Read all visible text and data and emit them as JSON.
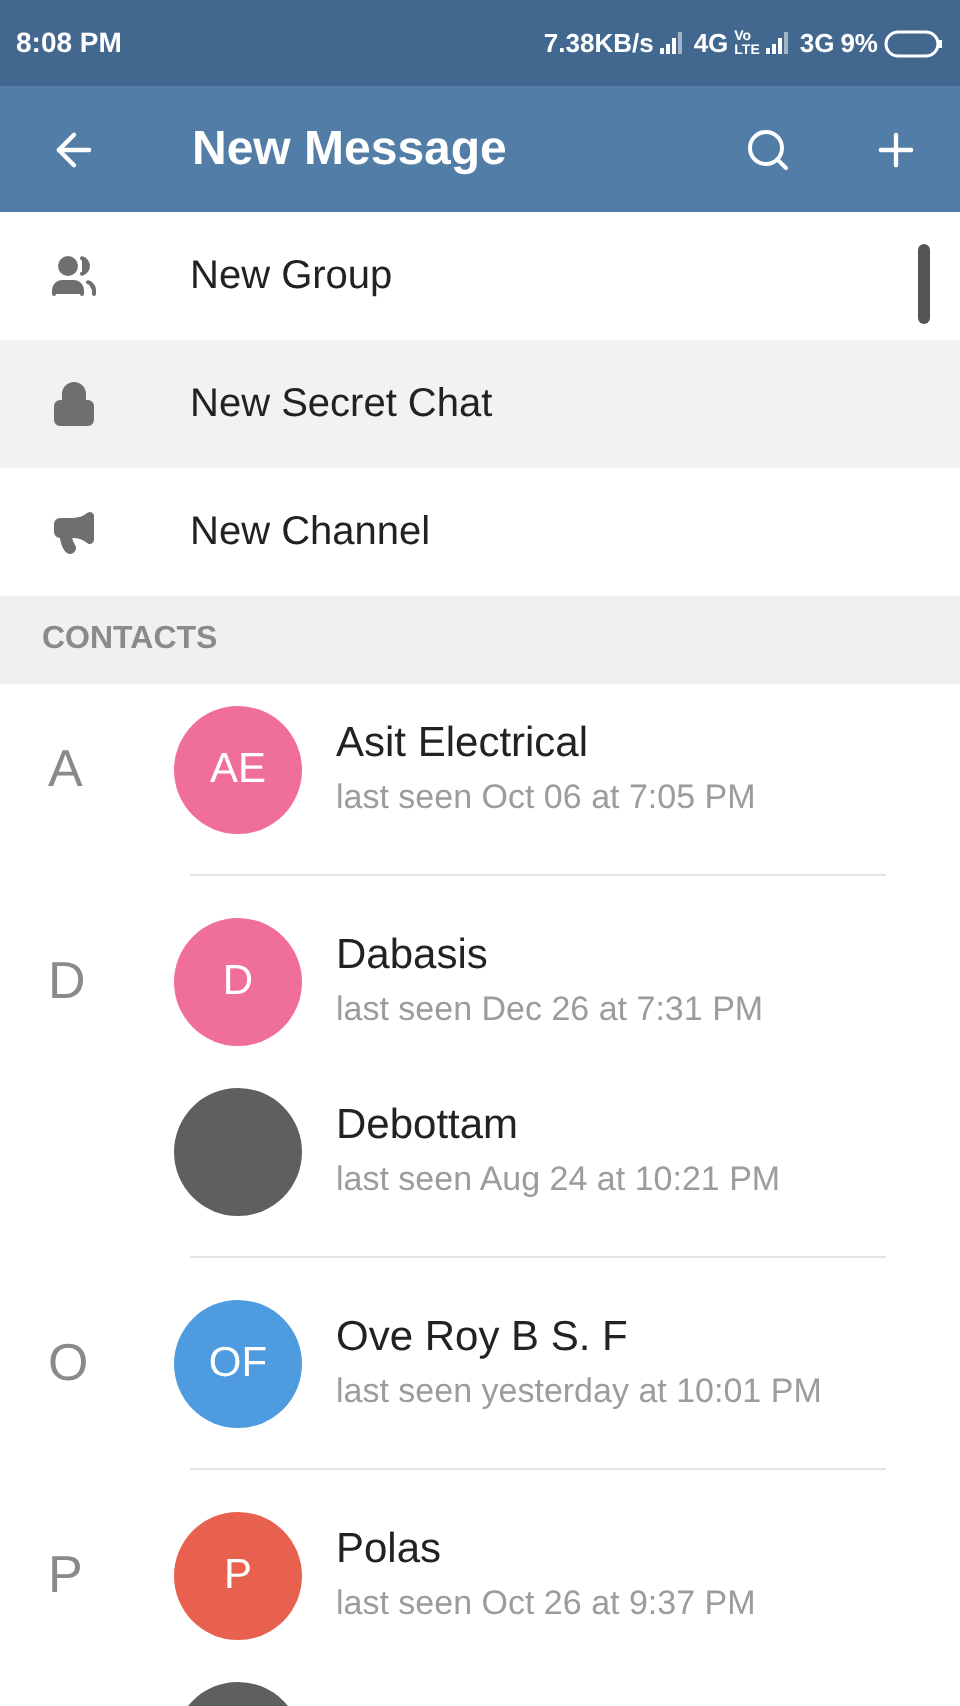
{
  "status_bar": {
    "time": "8:08 PM",
    "speed": "7.38KB/s",
    "network_1": "4G",
    "volte": [
      "Vo",
      "LTE"
    ],
    "network_2": "3G",
    "battery": "9%"
  },
  "header": {
    "title": "New Message"
  },
  "actions": [
    {
      "kind": "group",
      "label": "New Group",
      "highlighted": false
    },
    {
      "kind": "secret",
      "label": "New Secret Chat",
      "highlighted": true
    },
    {
      "kind": "channel",
      "label": "New Channel",
      "highlighted": false
    }
  ],
  "contacts_header": "CONTACTS",
  "sections": [
    {
      "letter": "A",
      "contacts": [
        {
          "kind": "initials",
          "initials": "AE",
          "color": "#f06f98",
          "name": "Asit Electrical",
          "status": "last seen Oct 06 at 7:05 PM"
        }
      ]
    },
    {
      "letter": "D",
      "contacts": [
        {
          "kind": "initials",
          "initials": "D",
          "color": "#f06f98",
          "name": "Dabasis",
          "status": "last seen Dec 26 at 7:31 PM"
        },
        {
          "kind": "photo",
          "name": "Debottam",
          "status": "last seen Aug 24 at 10:21 PM"
        }
      ]
    },
    {
      "letter": "O",
      "contacts": [
        {
          "kind": "initials",
          "initials": "OF",
          "color": "#4f9be0",
          "name": "Ove Roy B S. F",
          "status": "last seen yesterday at 10:01 PM"
        }
      ]
    },
    {
      "letter": "P",
      "contacts": [
        {
          "kind": "initials",
          "initials": "P",
          "color": "#e8614e",
          "name": "Polas",
          "status": "last seen Oct 26 at 9:37 PM"
        },
        {
          "kind": "photo"
        }
      ]
    }
  ]
}
